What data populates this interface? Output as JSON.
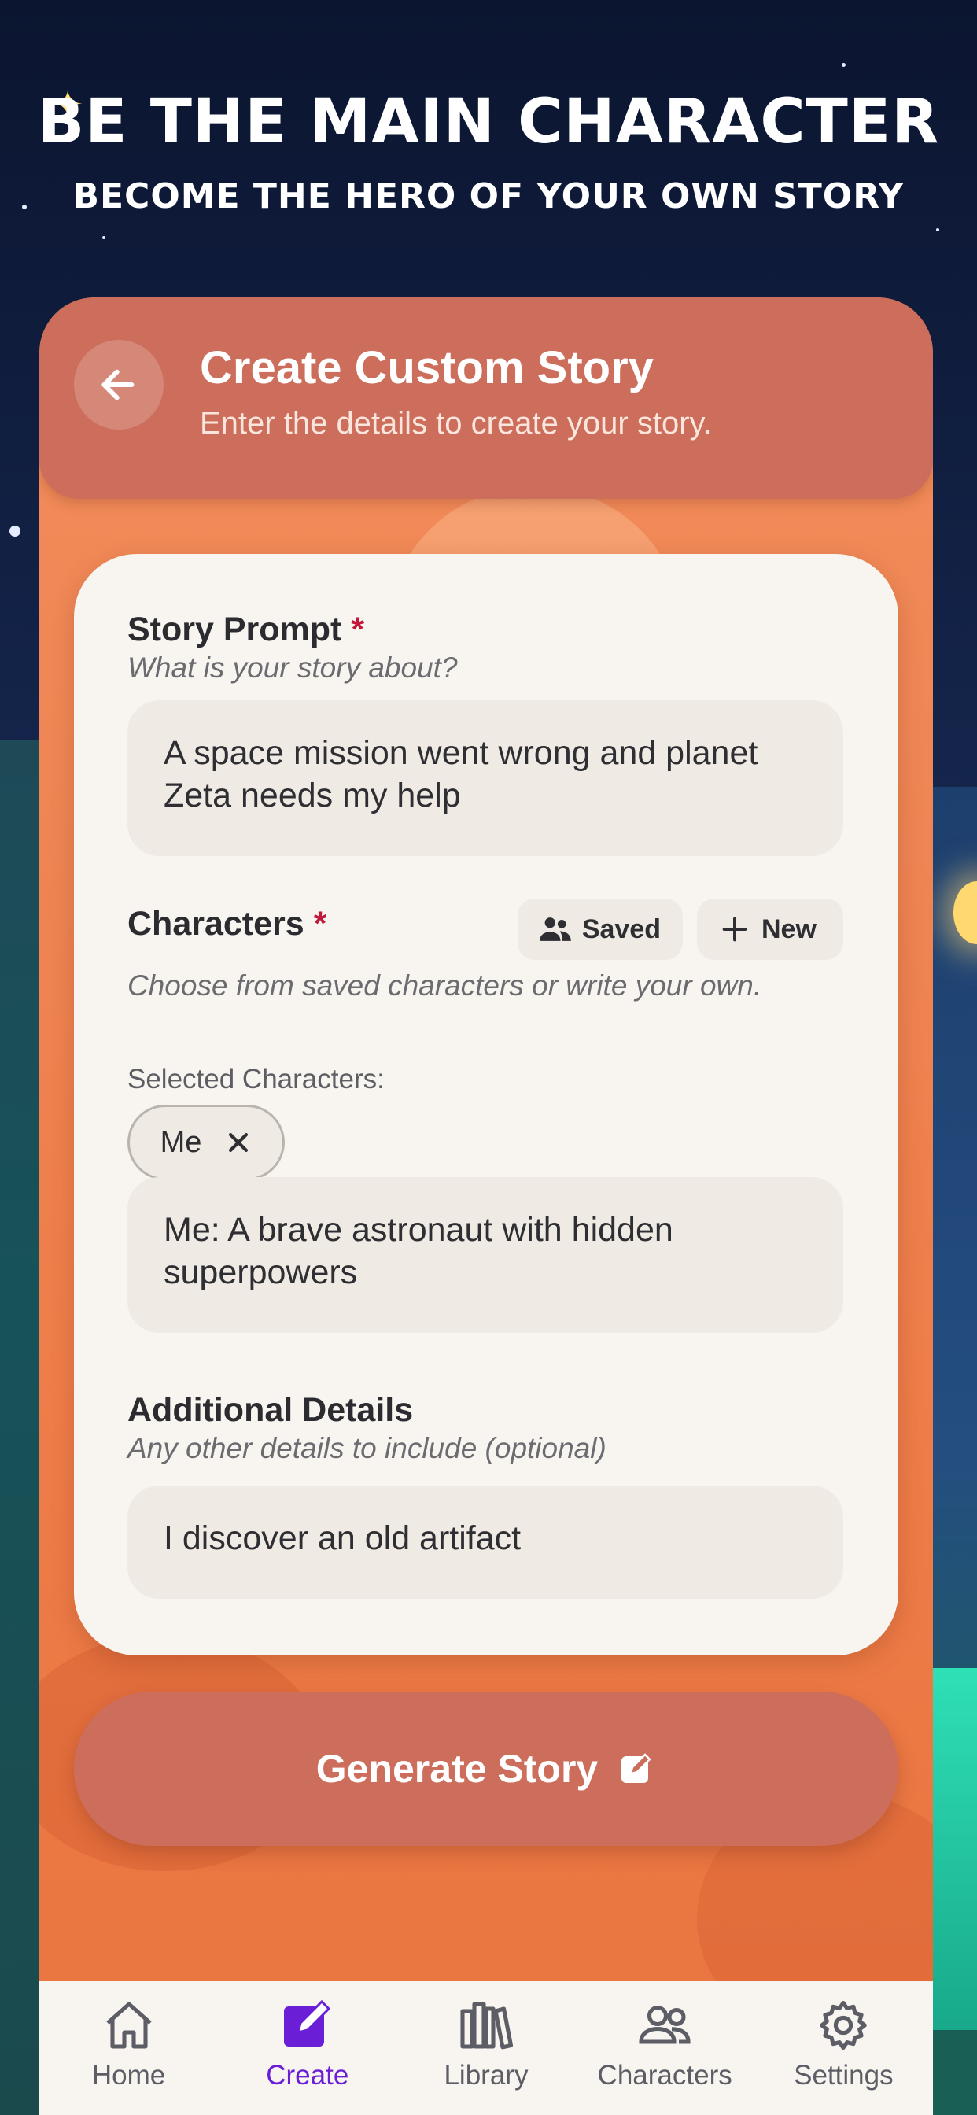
{
  "hero": {
    "title": "BE THE MAIN CHARACTER",
    "subtitle": "BECOME THE HERO OF YOUR OWN STORY"
  },
  "header": {
    "title": "Create Custom Story",
    "subtitle": "Enter the details to create your story."
  },
  "story_prompt": {
    "label": "Story Prompt",
    "required_mark": "*",
    "hint": "What is your story about?",
    "value": "A space mission went wrong and planet Zeta needs my help"
  },
  "characters": {
    "label": "Characters",
    "required_mark": "*",
    "saved_label": "Saved",
    "new_label": "New",
    "hint": "Choose from saved characters or write your own.",
    "selected_label": "Selected Characters:",
    "selected": [
      {
        "name": "Me"
      }
    ],
    "value": "Me: A brave astronaut with hidden superpowers"
  },
  "additional": {
    "label": "Additional Details",
    "hint": "Any other details to include (optional)",
    "value": "I discover an old artifact"
  },
  "generate_label": "Generate Story",
  "tabs": [
    {
      "label": "Home",
      "icon": "home-icon"
    },
    {
      "label": "Create",
      "icon": "edit-icon",
      "active": true
    },
    {
      "label": "Library",
      "icon": "library-icon"
    },
    {
      "label": "Characters",
      "icon": "users-icon"
    },
    {
      "label": "Settings",
      "icon": "gear-icon"
    }
  ],
  "colors": {
    "accent": "#6a1fd6",
    "header": "#cc6e5b",
    "panel": "#ef8554",
    "required": "#c0183a"
  }
}
